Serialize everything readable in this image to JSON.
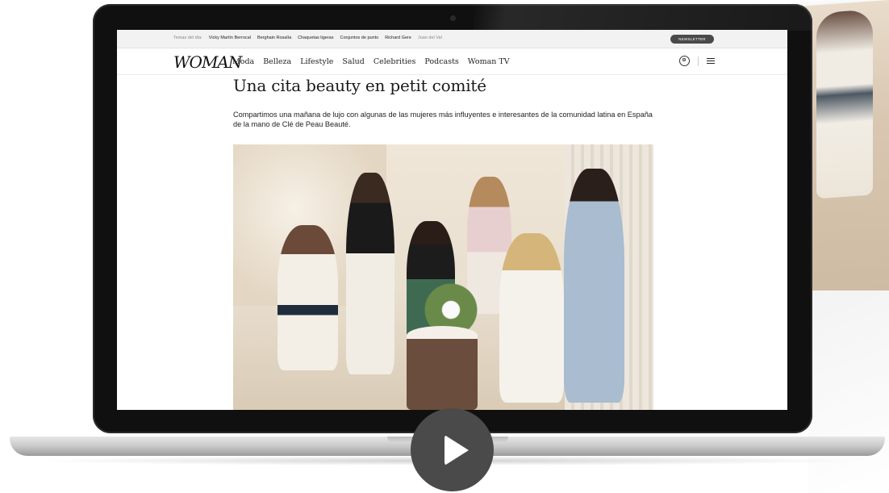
{
  "topbar": {
    "trending_label": "Temas del día:",
    "trending": [
      "Vicky Martín Berrocal",
      "Berghain Rosalía",
      "Chaquetas ligeras",
      "Conjuntos de punto",
      "Richard Gere",
      "Juan del Val"
    ],
    "newsletter_label": "NEWSLETTER"
  },
  "navbar": {
    "logo": "WOMAN",
    "items": [
      "Moda",
      "Belleza",
      "Lifestyle",
      "Salud",
      "Celebrities",
      "Podcasts",
      "Woman TV"
    ]
  },
  "article": {
    "headline": "Una cita beauty en petit comité",
    "lead": "Compartimos una mañana de lujo con algunas de las mujeres más influyentes e interesantes de la comunidad latina en España de la mano de Clé de Peau Beauté."
  },
  "icons": {
    "user": "user-icon",
    "menu": "menu-icon",
    "play": "play-icon"
  },
  "colors": {
    "newsletter_bg": "#4a4a4a",
    "play_bg": "#4a4a4a",
    "laptop_bezel": "#101010"
  }
}
